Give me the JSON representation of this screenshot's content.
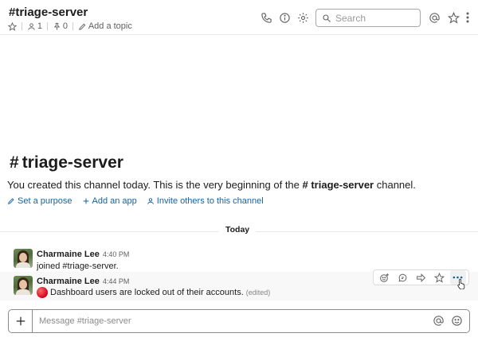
{
  "header": {
    "channel_title": "#triage-server",
    "members_count": "1",
    "pins_count": "0",
    "add_topic": "Add a topic",
    "search_placeholder": "Search"
  },
  "intro": {
    "hash": "#",
    "title": "triage-server",
    "text_before": "You created this channel today. This is the very beginning of the ",
    "channel_ref": "# triage-server",
    "text_after": " channel.",
    "links": {
      "purpose": "Set a purpose",
      "app": "Add an app",
      "invite": "Invite others to this channel"
    }
  },
  "divider": {
    "label": "Today"
  },
  "messages": [
    {
      "author": "Charmaine Lee",
      "time": "4:40 PM",
      "text": "joined #triage-server."
    },
    {
      "author": "Charmaine Lee",
      "time": "4:44 PM",
      "text": "Dashboard users are locked out of their accounts.",
      "edited": "(edited)",
      "emoji": "red-circle"
    }
  ],
  "composer": {
    "placeholder": "Message #triage-server"
  },
  "colors": {
    "link": "#1264a3",
    "text": "#1d1c1d",
    "muted": "#616061"
  }
}
